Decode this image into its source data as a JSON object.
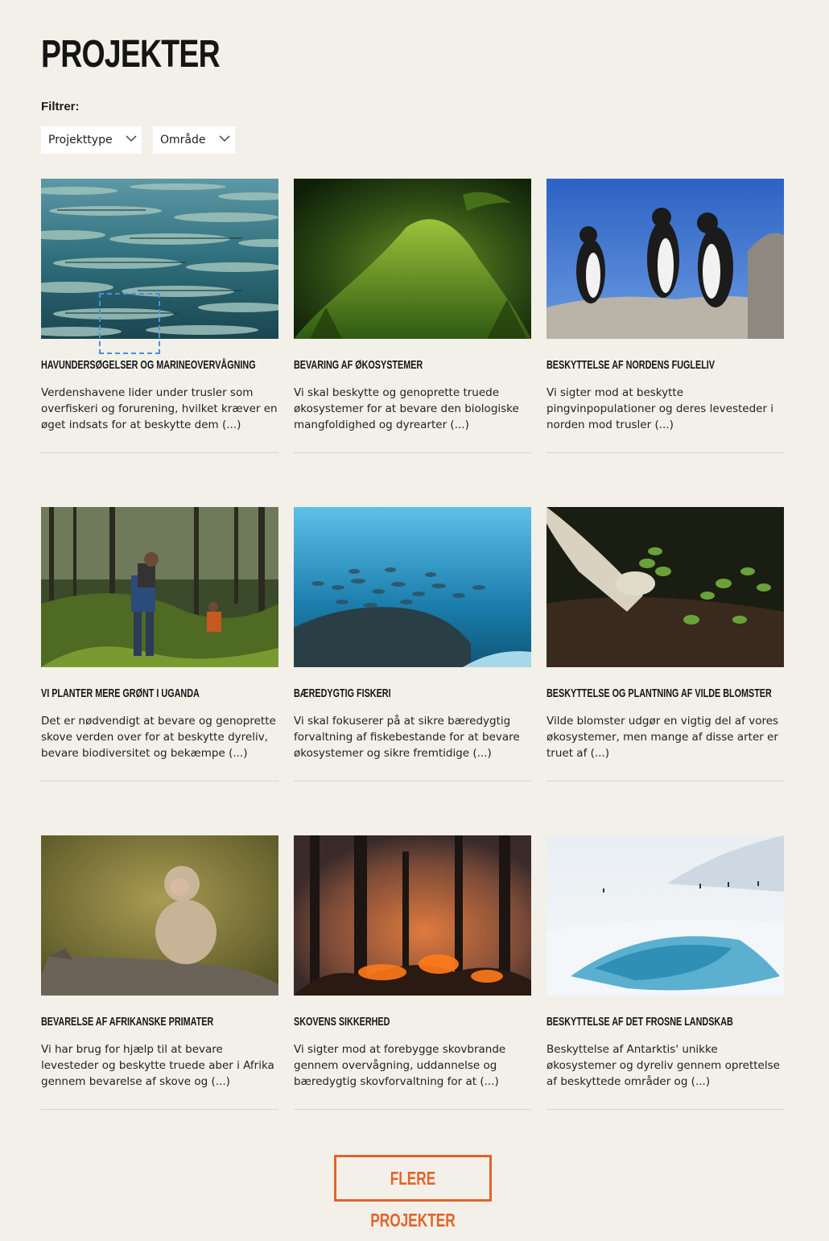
{
  "page": {
    "title": "PROJEKTER"
  },
  "filters": {
    "label": "Filtrer:",
    "dropdowns": [
      {
        "label": "Projekttype",
        "icon": "chevron-down-icon"
      },
      {
        "label": "Område",
        "icon": "chevron-down-icon"
      }
    ]
  },
  "projects": [
    {
      "title": "Havundersøgelser og marineovervågning",
      "text": "Verdenshavene lider under trusler som overfiskeri og forurening, hvilket kræver en øget indsats for at beskytte dem (...)",
      "image": "school-of-barracuda-photo"
    },
    {
      "title": "Bevaring af økosystemer",
      "text": "Vi skal beskytte og genoprette truede økosystemer for at bevare den biologiske mangfoldighed og dyrearter (...)",
      "image": "moss-and-ferns-photo"
    },
    {
      "title": "Beskyttelse af nordens fugleliv",
      "text": "Vi sigter mod at beskytte pingvinpopulationer og deres levesteder i norden mod trusler (...)",
      "image": "penguins-on-rock-photo"
    },
    {
      "title": "Vi planter mere grønt i Uganda",
      "text": "Det er nødvendigt at bevare og genoprette skove verden over for at beskytte dyreliv, bevare biodiversitet og bekæmpe (...)",
      "image": "hikers-in-forest-photo"
    },
    {
      "title": "Bæredygtig fiskeri",
      "text": "Vi skal fokuserer på at sikre bæredygtig forvaltning af fiskebestande for at bevare økosystemer og sikre fremtidige (...)",
      "image": "underwater-fish-reef-photo"
    },
    {
      "title": "Beskyttelse og plantning af vilde blomster",
      "text": "Vilde blomster udgør en vigtig del af vores økosystemer, men mange af disse arter er truet af (...)",
      "image": "gloved-hands-planting-photo"
    },
    {
      "title": "Bevarelse af afrikanske primater",
      "text": "Vi har brug for hjælp til at bevare levesteder og beskytte truede aber i Afrika gennem bevarelse af skove og (...)",
      "image": "macaque-on-branch-photo"
    },
    {
      "title": "Skovens sikkerhed",
      "text": "Vi sigter mod at forebygge skovbrande gennem overvågning, uddannelse og bæredygtig skovforvaltning for at (...)",
      "image": "forest-fire-photo"
    },
    {
      "title": "Beskyttelse af det frosne landskab",
      "text": "Beskyttelse af Antarktis' unikke økosystemer og dyreliv gennem oprettelse af beskyttede områder og (...)",
      "image": "antarctic-ice-landscape-photo"
    }
  ],
  "more_button": {
    "label": "FLERE PROJEKTER"
  },
  "colors": {
    "background": "#f2f0e8",
    "accent": "#e3632a",
    "divider": "#d8d5ca"
  }
}
